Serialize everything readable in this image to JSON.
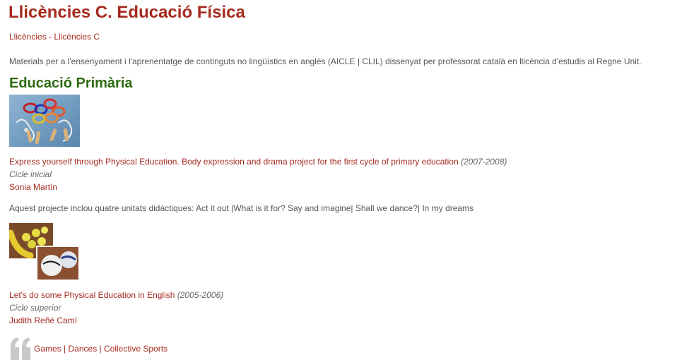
{
  "page": {
    "title": "Llicències C. Educació Física",
    "breadcrumb": [
      "Llicències",
      "Llicències C"
    ],
    "breadcrumb_separator": " - ",
    "intro": "Materials per a l'ensenyament i l'aprenentatge de continguts no lingüístics en anglès (AICLE | CLIL) dissenyat per professorat català en llicència d'estudis al Regne Unit."
  },
  "section": {
    "heading": "Educació Primària"
  },
  "projects": [
    {
      "title": "Express yourself through Physical Education. Body expression and drama project for the first cycle of primary education",
      "years": "(2007-2008)",
      "cycle": "Cicle inicial",
      "author": "Sonia Martín",
      "description": "Aquest projecte inclou quatre unitats didàctiques: Act it out |What is it for? Say and imagine| Shall we dance?| In my dreams",
      "image_icon": "jump-ropes-photo"
    },
    {
      "title": "Let's do some Physical Education in English",
      "years": "(2005-2006)",
      "cycle": "Cicle superior",
      "author": "Judith Reñé Camí",
      "image_icon": "balls-photo"
    }
  ],
  "tags": {
    "items": [
      "Games",
      "Dances",
      "Collective Sports"
    ],
    "separator": "|",
    "icon": "quote-icon"
  },
  "colors": {
    "accent": "#a52a1e",
    "heading_green": "#2e6b0f",
    "text": "#555555",
    "quote_grey": "#c8c8c8"
  }
}
